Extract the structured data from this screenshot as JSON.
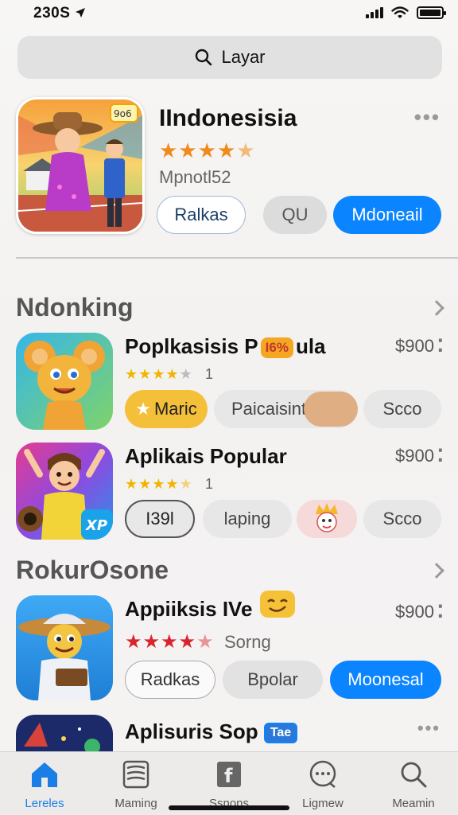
{
  "status_bar": {
    "time": "230S"
  },
  "search": {
    "label": "Layar"
  },
  "featured": {
    "title": "IIndonesisia",
    "rating": 4.5,
    "subtitle": "Mpnotl52",
    "buttons": [
      "Ralkas",
      "QU",
      "Mdoneail"
    ]
  },
  "sections": [
    {
      "title": "Ndonking"
    },
    {
      "title": "RokurOsone"
    }
  ],
  "apps": [
    {
      "name": "Poplkasisis P",
      "name_badge": "I6%",
      "name_tail": "ula",
      "price": "$900",
      "rating": 4.5,
      "rating_count": "1",
      "tags": [
        "Maric",
        "Paicaisint",
        "Scco"
      ]
    },
    {
      "name": "Aplikais Popular",
      "price": "$900",
      "rating": 4.5,
      "rating_count": "1",
      "tags": [
        "I39l",
        "laping",
        "",
        "Scco"
      ],
      "icon_badge": "XP"
    },
    {
      "name": "Appiiksis IVe",
      "price": "$900",
      "rating": 4.5,
      "rating_label": "Sorng",
      "tags": [
        "Radkas",
        "Bpolar",
        "Moonesal"
      ]
    },
    {
      "name": "Aplisuris Sop",
      "name_badge": "Tae"
    }
  ],
  "tab_bar": {
    "tabs": [
      {
        "label": "Lereles",
        "icon": "home-icon",
        "active": true
      },
      {
        "label": "Maming",
        "icon": "layers-icon"
      },
      {
        "label": "Ssnons",
        "icon": "f-book-icon"
      },
      {
        "label": "Ligmew",
        "icon": "chat-bubble-icon"
      },
      {
        "label": "Meamin",
        "icon": "search-icon"
      }
    ]
  },
  "colors": {
    "accent": "#0a84ff",
    "star_orange": "#f08a1c",
    "star_gold": "#f2b400",
    "star_red": "#d9242b"
  }
}
